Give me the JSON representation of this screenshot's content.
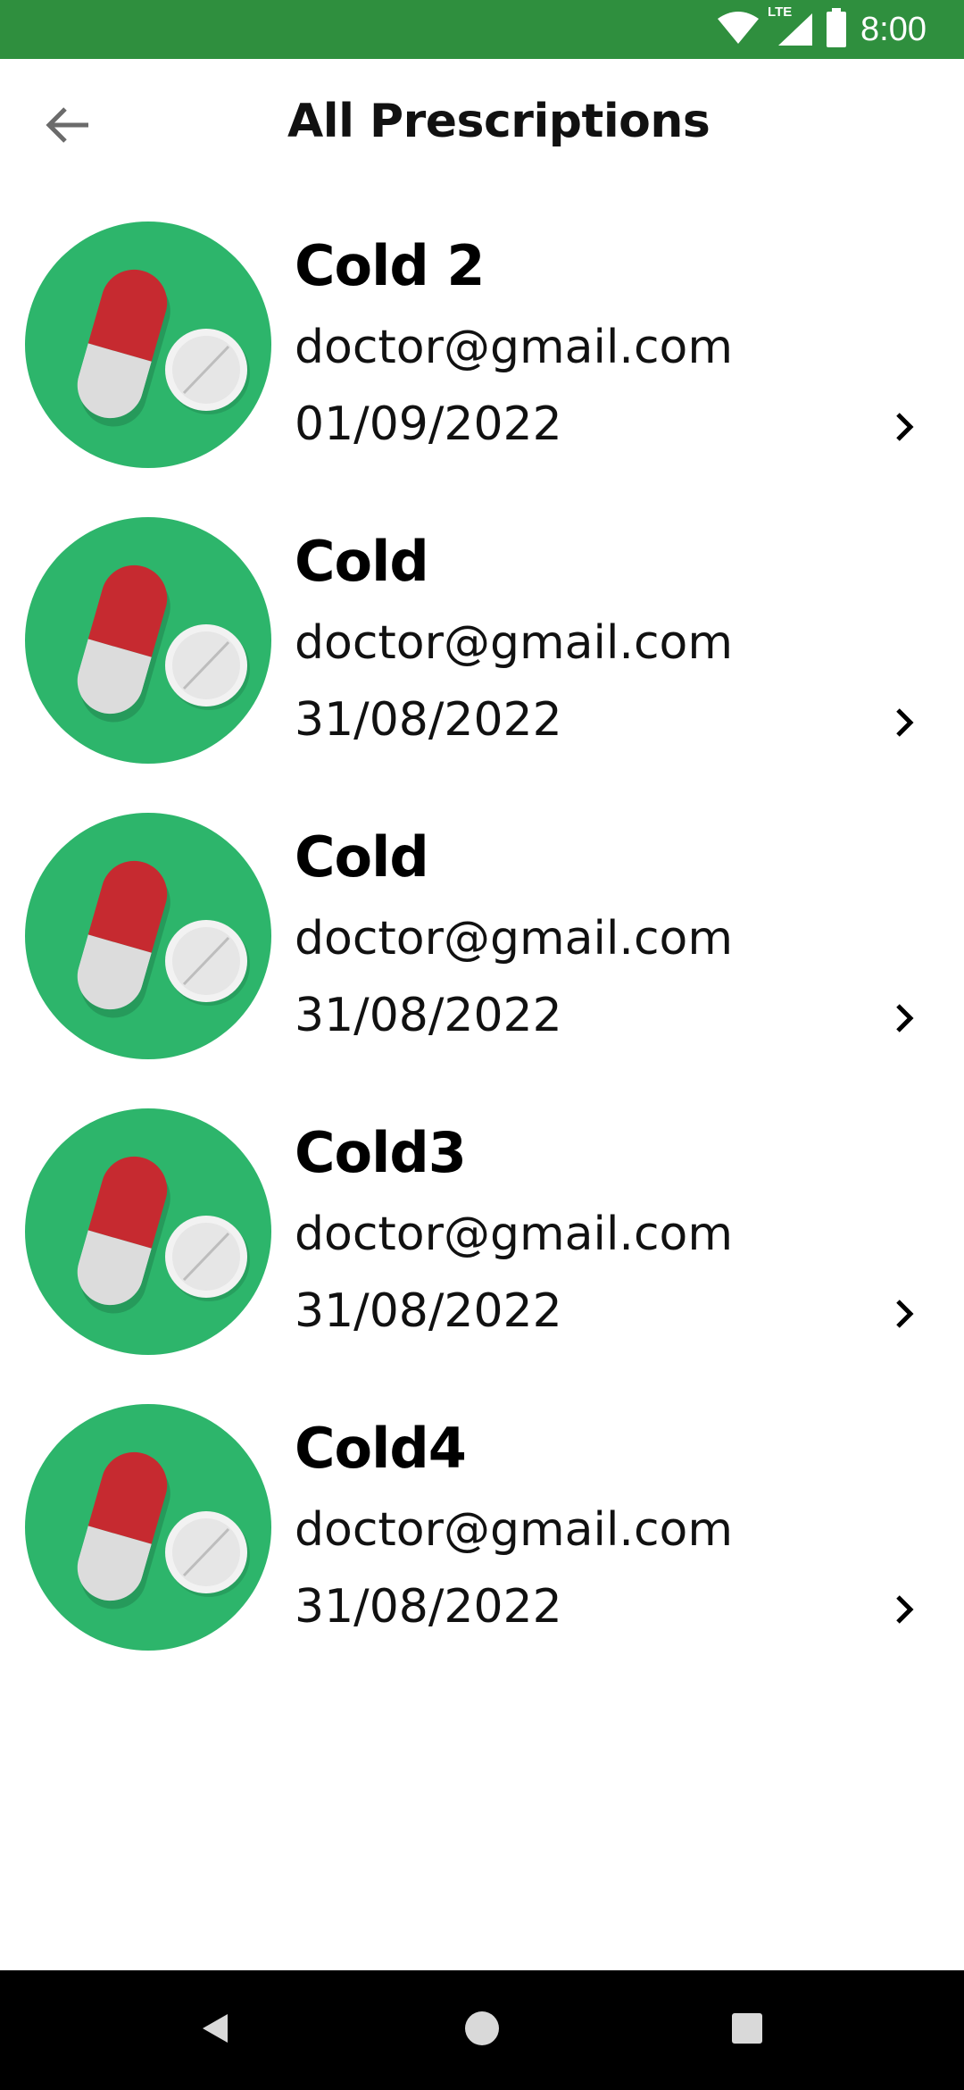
{
  "status_bar": {
    "time": "8:00",
    "network_label": "LTE",
    "icons": [
      "wifi-icon",
      "cellular-signal-icon",
      "battery-icon"
    ]
  },
  "app_bar": {
    "title": "All Prescriptions",
    "back_icon": "arrow-left-icon"
  },
  "prescriptions": [
    {
      "name": "Cold 2",
      "doctor": "doctor@gmail.com",
      "date": "01/09/2022"
    },
    {
      "name": "Cold",
      "doctor": "doctor@gmail.com",
      "date": "31/08/2022"
    },
    {
      "name": "Cold",
      "doctor": "doctor@gmail.com",
      "date": "31/08/2022"
    },
    {
      "name": "Cold3",
      "doctor": "doctor@gmail.com",
      "date": "31/08/2022"
    },
    {
      "name": "Cold4",
      "doctor": "doctor@gmail.com",
      "date": "31/08/2022"
    }
  ],
  "nav_bar": {
    "icons": [
      "back-triangle-icon",
      "home-circle-icon",
      "recents-square-icon"
    ]
  },
  "colors": {
    "status_bar": "#2f8f3e",
    "avatar_bg": "#2db56b",
    "capsule_red": "#c62a30",
    "capsule_white": "#dcdcdc"
  }
}
